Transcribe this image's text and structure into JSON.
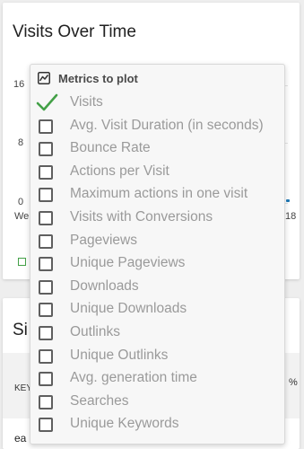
{
  "chart_card": {
    "title": "Visits Over Time",
    "y_ticks": [
      "16",
      "8",
      "0"
    ],
    "x_left_label": "We",
    "x_right_label": "18"
  },
  "sites_card": {
    "title_partial": "Si",
    "header_left": "KEY",
    "header_right": "%",
    "row_first_partial": "ea"
  },
  "metrics_dropdown": {
    "title": "Metrics to plot",
    "items": [
      {
        "label": "Visits",
        "checked": true
      },
      {
        "label": "Avg. Visit Duration (in seconds)",
        "checked": false
      },
      {
        "label": "Bounce Rate",
        "checked": false
      },
      {
        "label": "Actions per Visit",
        "checked": false
      },
      {
        "label": "Maximum actions in one visit",
        "checked": false
      },
      {
        "label": "Visits with Conversions",
        "checked": false
      },
      {
        "label": "Pageviews",
        "checked": false
      },
      {
        "label": "Unique Pageviews",
        "checked": false
      },
      {
        "label": "Downloads",
        "checked": false
      },
      {
        "label": "Unique Downloads",
        "checked": false
      },
      {
        "label": "Outlinks",
        "checked": false
      },
      {
        "label": "Unique Outlinks",
        "checked": false
      },
      {
        "label": "Avg. generation time",
        "checked": false
      },
      {
        "label": "Searches",
        "checked": false
      },
      {
        "label": "Unique Keywords",
        "checked": false
      }
    ]
  },
  "colors": {
    "check": "#43a047",
    "series": "#1f78b4"
  }
}
